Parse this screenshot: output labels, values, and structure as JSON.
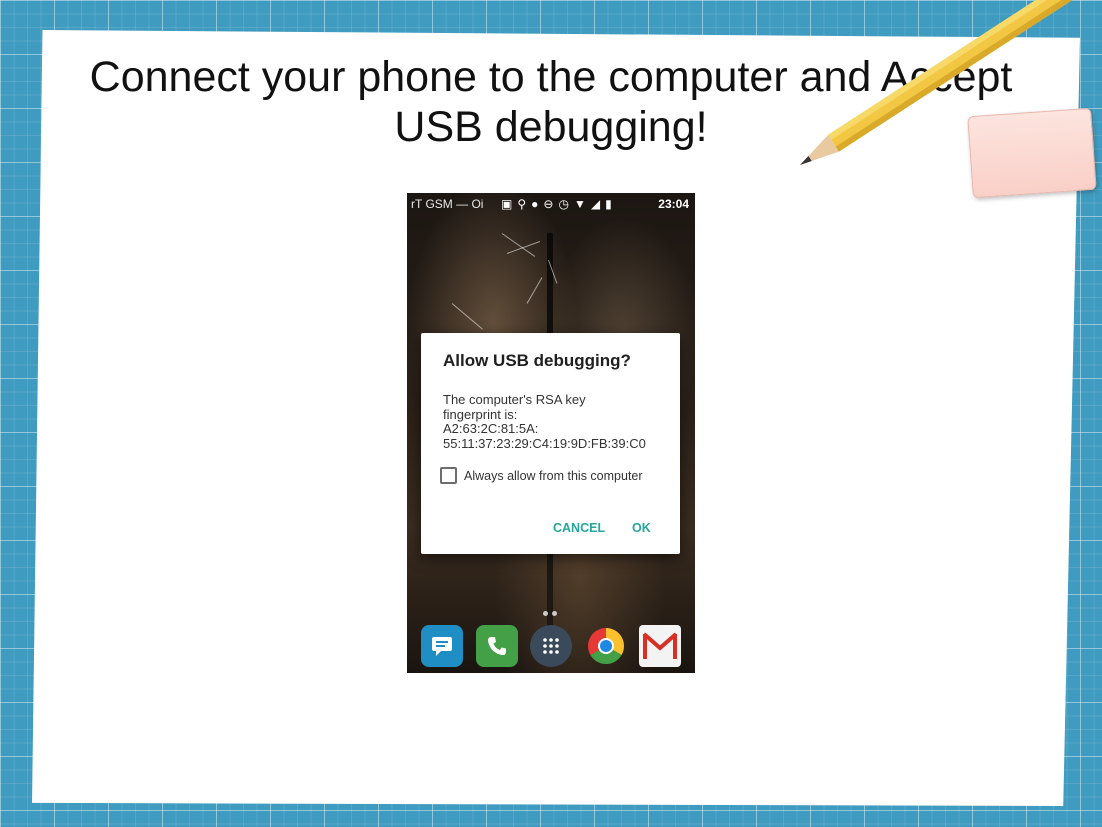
{
  "slide": {
    "title_line1": "Connect your phone to the computer and Accept",
    "title_line2": "USB debugging!"
  },
  "statusbar": {
    "carrier": "rT GSM — Oi",
    "time": "23:04",
    "icons": [
      "chat-icon",
      "search-icon",
      "android-icon",
      "do-not-disturb-icon",
      "alarm-icon",
      "wifi-icon",
      "signal-icon",
      "battery-icon"
    ]
  },
  "dialog": {
    "title": "Allow USB debugging?",
    "body_line1": "The computer's RSA key",
    "body_line2": "fingerprint is:",
    "body_line3": "A2:63:2C:81:5A:",
    "body_line4": "55:11:37:23:29:C4:19:9D:FB:39:C0",
    "checkbox_label": "Always allow from this computer",
    "checkbox_checked": false,
    "cancel_label": "CANCEL",
    "ok_label": "OK",
    "accent_color": "#26a69a"
  },
  "dock": {
    "apps": [
      "messages-icon",
      "phone-icon",
      "app-drawer-icon",
      "chrome-icon",
      "gmail-icon"
    ]
  },
  "colors": {
    "background_grid": "#3f9bbf",
    "paper": "#ffffff",
    "pencil": "#f2c744",
    "sticky_note": "#fbd9d1"
  }
}
